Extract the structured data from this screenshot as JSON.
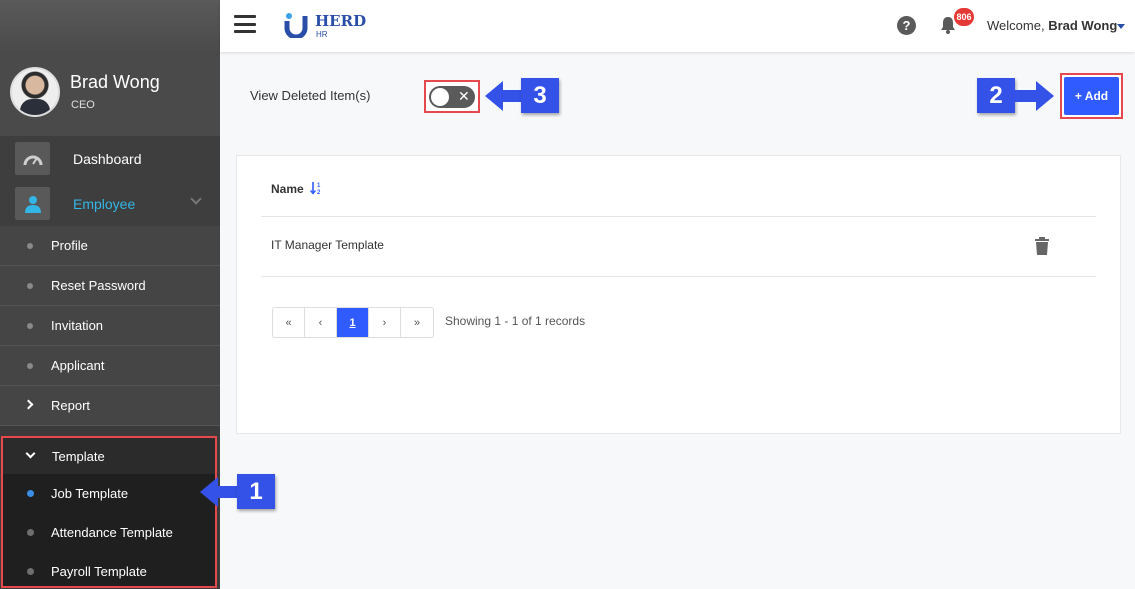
{
  "user": {
    "name": "Brad Wong",
    "role": "CEO"
  },
  "nav": {
    "dashboard": "Dashboard",
    "employee": "Employee",
    "sub_items": [
      "Profile",
      "Reset Password",
      "Invitation",
      "Applicant"
    ],
    "report": "Report",
    "template": "Template",
    "template_items": [
      "Job Template",
      "Attendance Template",
      "Payroll Template"
    ]
  },
  "header": {
    "logo_text": "HERD",
    "logo_sub": "HR",
    "help": "?",
    "notification_count": "806",
    "welcome": "Welcome,",
    "welcome_name": "Brad Wong"
  },
  "toolbar": {
    "view_deleted_label": "View Deleted Item(s)",
    "toggle_x": "✕",
    "add_label": "+ Add"
  },
  "table": {
    "column_name": "Name",
    "sort_icon": "↓",
    "rows": [
      {
        "name": "IT Manager Template"
      }
    ]
  },
  "pagination": {
    "first": "«",
    "prev": "‹",
    "current": "1",
    "next": "›",
    "last": "»",
    "summary": "Showing 1 - 1 of 1 records"
  },
  "callouts": {
    "one": "1",
    "two": "2",
    "three": "3"
  },
  "colors": {
    "accent": "#2f5bff",
    "callout": "#3452e8",
    "highlight_border": "#e5484d",
    "active_nav": "#33b5e5"
  }
}
